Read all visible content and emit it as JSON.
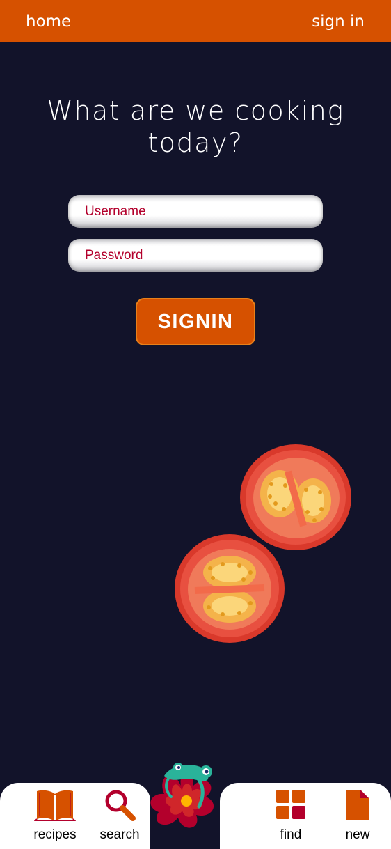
{
  "topbar": {
    "home_label": "home",
    "signin_label": "sign in",
    "color": "#d65100"
  },
  "hero": {
    "headline_line1": "What are we cooking",
    "headline_line2": "today?"
  },
  "form": {
    "username_placeholder": "Username",
    "password_placeholder": "Password",
    "submit_label": "SIGNIN",
    "accent": "#b3002c"
  },
  "decor": {
    "tomato_icon": "tomato-slice",
    "mascot_icon": "lizard-flower-logo"
  },
  "bottom_nav": {
    "items": [
      {
        "label": "recipes",
        "icon": "open-book-icon"
      },
      {
        "label": "search",
        "icon": "magnifier-icon"
      },
      {
        "label": "find",
        "icon": "grid-icon"
      },
      {
        "label": "new",
        "icon": "new-document-icon"
      }
    ]
  }
}
